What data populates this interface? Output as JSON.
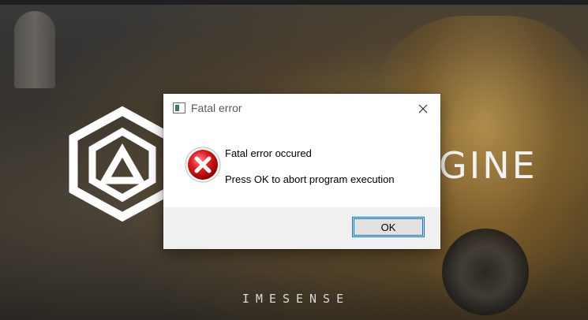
{
  "background": {
    "engine_text": "GINE",
    "brand_text": "IMESENSE"
  },
  "dialog": {
    "title": "Fatal error",
    "message_line1": "Fatal error occured",
    "message_line2": "Press OK to abort program execution",
    "ok_label": "OK",
    "icon": "error-icon",
    "accent_color": "#0078d7"
  }
}
